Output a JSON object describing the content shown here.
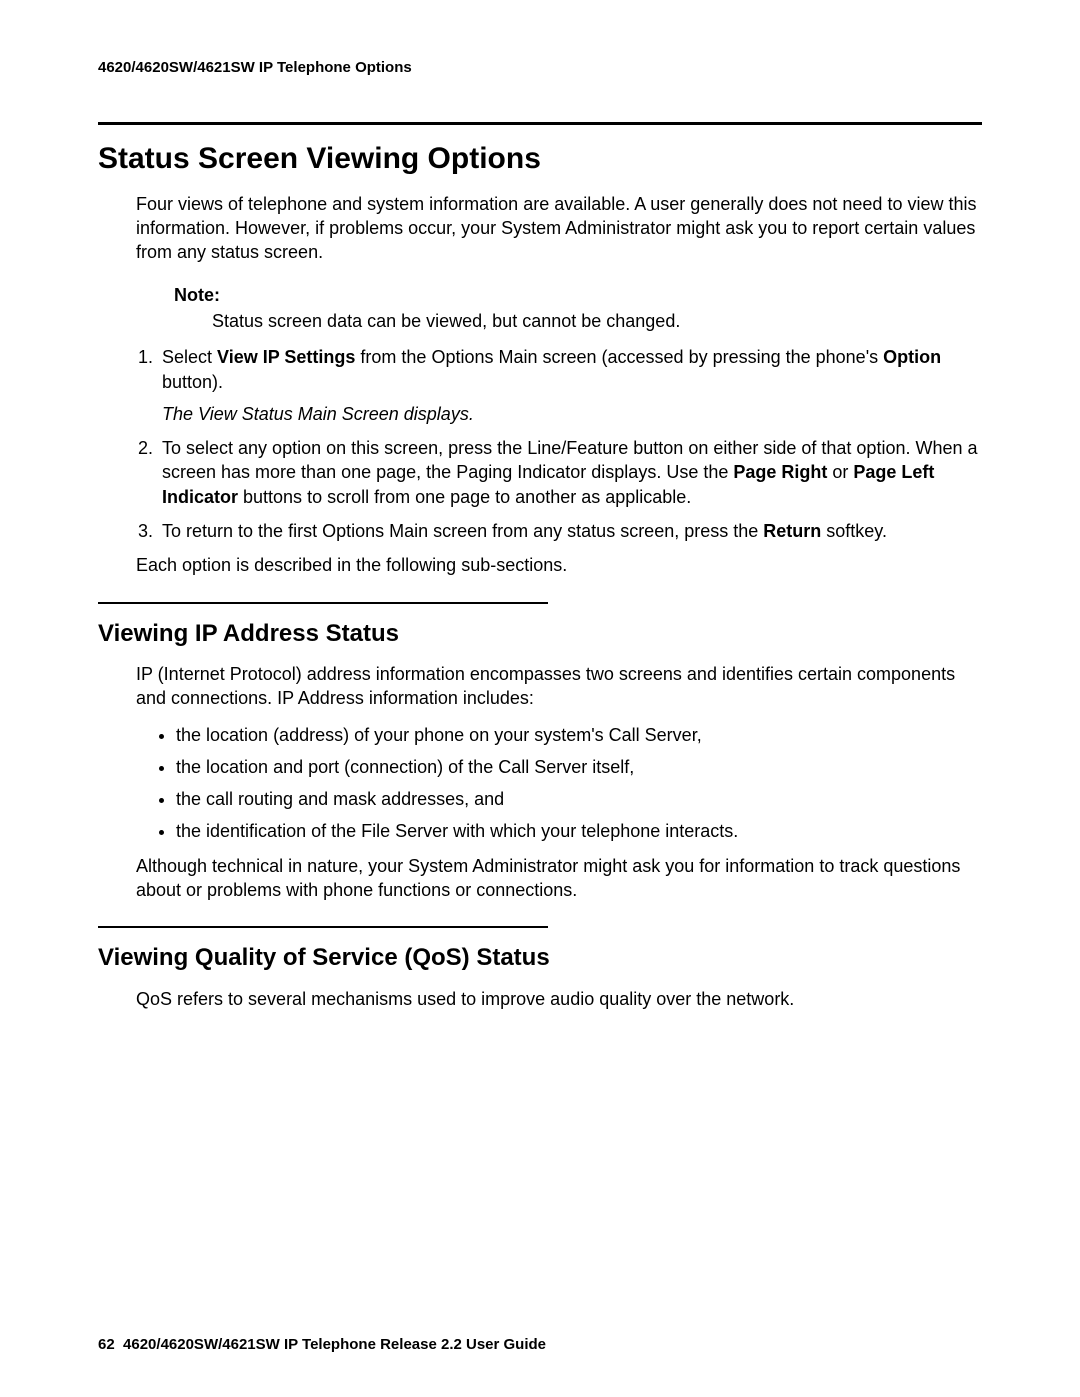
{
  "header": {
    "running": "4620/4620SW/4621SW IP Telephone Options"
  },
  "h1": "Status Screen Viewing Options",
  "intro": "Four views of telephone and system information are available. A user generally does not need to view this information. However, if problems occur, your System Administrator might ask you to report certain values from any status screen.",
  "note": {
    "label": "Note:",
    "body": "Status screen data can be viewed, but cannot be changed."
  },
  "steps": {
    "s1_a": "Select ",
    "s1_bold1": "View IP Settings",
    "s1_b": " from the Options Main screen (accessed by pressing the phone's ",
    "s1_bold2": "Option",
    "s1_c": " button).",
    "s1_result": "The View Status Main Screen displays.",
    "s2_a": "To select any option on this screen, press the Line/Feature button on either side of that option. When a screen has more than one page, the Paging Indicator displays. Use the ",
    "s2_bold1": "Page Right",
    "s2_b": " or ",
    "s2_bold2": "Page Left Indicator",
    "s2_c": " buttons to scroll from one page to another as applicable.",
    "s3_a": "To return to the first Options Main screen from any status screen, press the ",
    "s3_bold1": "Return",
    "s3_b": " softkey."
  },
  "after_steps": "Each option is described in the following sub-sections.",
  "section_ip": {
    "title": "Viewing IP Address Status",
    "intro": "IP (Internet Protocol) address information encompasses two screens and identifies certain components and connections. IP Address information includes:",
    "bullets": [
      "the location (address) of your phone on your system's Call Server,",
      "the location and port (connection) of the Call Server itself,",
      "the call routing and mask addresses, and",
      "the identification of the File Server with which your telephone interacts."
    ],
    "outro": "Although technical in nature, your System Administrator might ask you for information to track questions about or problems with phone functions or connections."
  },
  "section_qos": {
    "title": "Viewing Quality of Service (QoS) Status",
    "body": "QoS refers to several mechanisms used to improve audio quality over the network."
  },
  "footer": {
    "page_number": "62",
    "doc_title": "4620/4620SW/4621SW IP Telephone Release 2.2 User Guide"
  }
}
